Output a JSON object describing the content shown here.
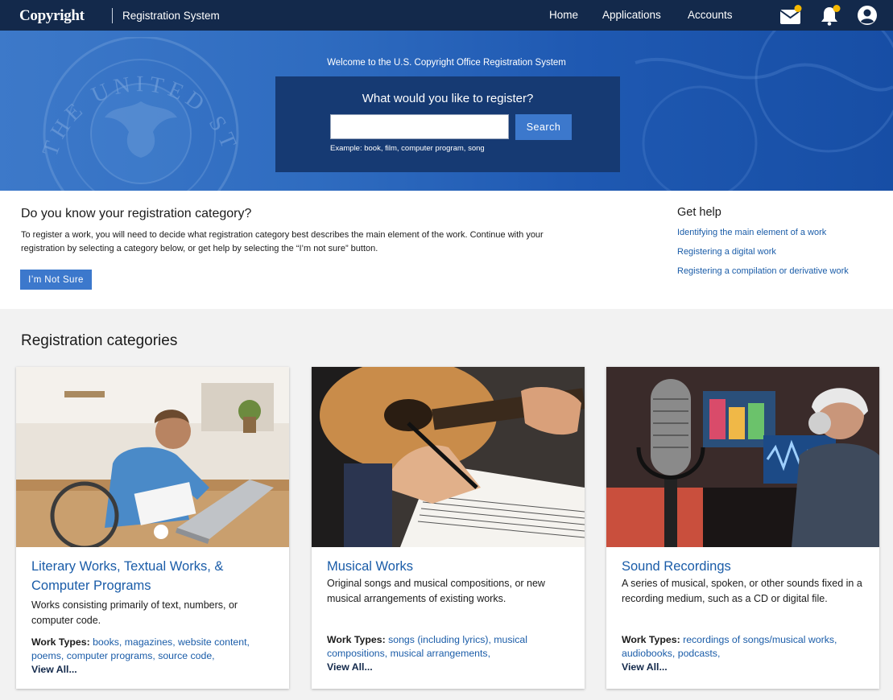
{
  "nav": {
    "logo": "Copyright",
    "system_name": "Registration System",
    "links": [
      "Home",
      "Applications",
      "Accounts"
    ],
    "icons": [
      "mail-icon",
      "bell-icon",
      "user-icon"
    ],
    "colors": {
      "bar": "#13294b",
      "badge": "#f5b800"
    }
  },
  "hero": {
    "welcome": "Welcome to the U.S. Copyright Office Registration System",
    "question": "What would you like to register?",
    "search_value": "",
    "search_button": "Search",
    "example": "Example: book, film, computer program, song",
    "seal_text": "THE UNITED STATES COPYRIGHT"
  },
  "intro": {
    "heading": "Do you know your registration category?",
    "text": "To register a work, you will need to decide what registration category best describes the main element of the work. Continue with your registration by selecting a category below, or get help by selecting the “I’m not sure” button.",
    "button": "I’m Not Sure"
  },
  "help": {
    "heading": "Get help",
    "links": [
      "Identifying the main element of a work",
      "Registering a digital work",
      "Registering a compilation or derivative work"
    ]
  },
  "categories": {
    "heading": "Registration categories",
    "work_types_label": "Work Types:",
    "view_all": "View All...",
    "cards": [
      {
        "title": "Literary Works, Textual Works, & Computer Programs",
        "description": "Works consisting primarily of text, numbers, or computer code.",
        "work_types": "books, magazines, website content, poems, computer programs, source code,"
      },
      {
        "title": "Musical Works",
        "description": "Original songs and musical compositions, or new musical arrangements of existing works.",
        "work_types": "songs (including lyrics), musical compositions, musical arrangements,"
      },
      {
        "title": "Sound Recordings",
        "description": "A series of musical, spoken, or other sounds fixed in a recording medium, such as a CD or digital file.",
        "work_types": "recordings of songs/musical works, audiobooks, podcasts,"
      }
    ]
  }
}
